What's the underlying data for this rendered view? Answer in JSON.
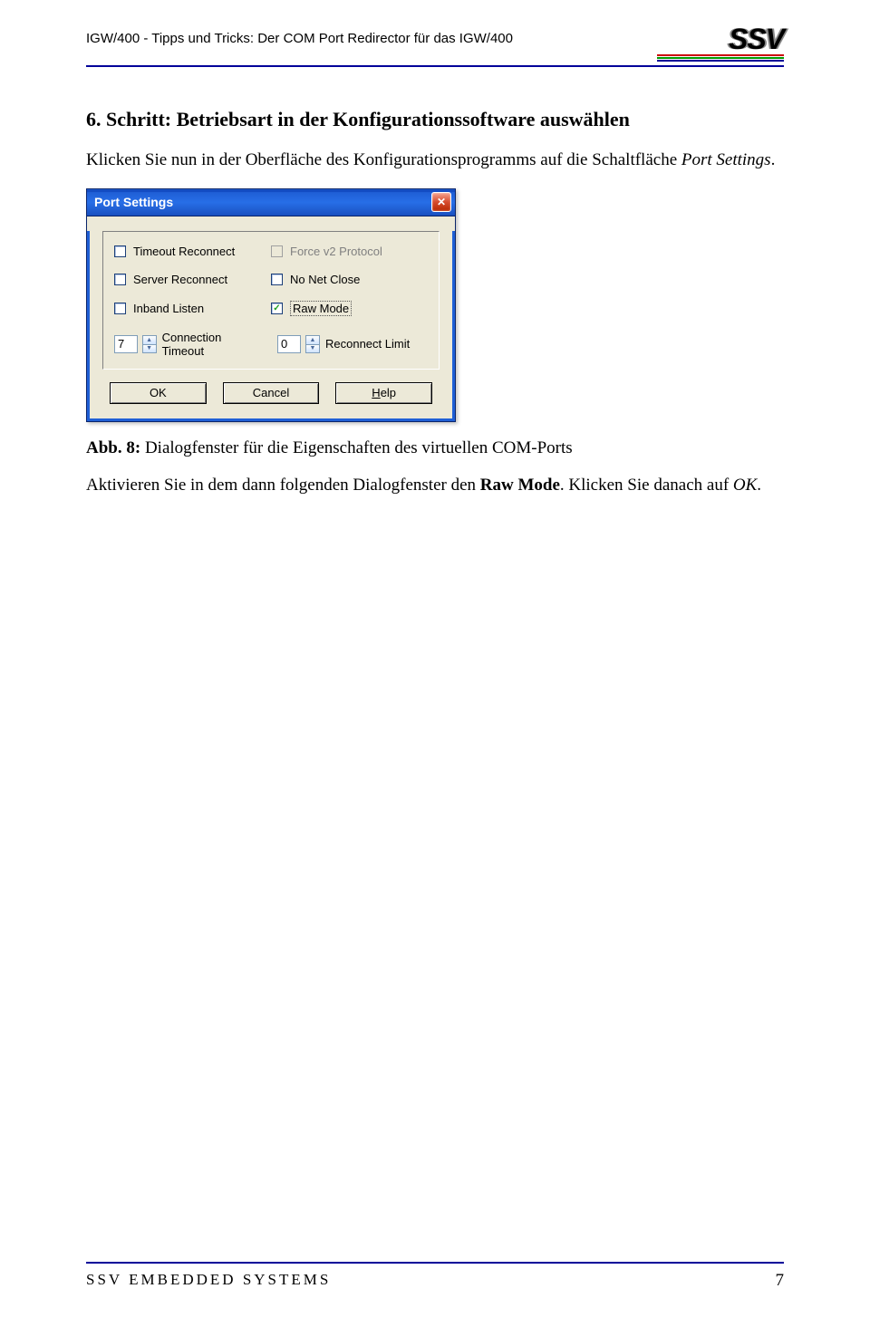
{
  "header": {
    "doc_title": "IGW/400 - Tipps und Tricks: Der COM Port Redirector für das IGW/400",
    "logo_text": "SSV"
  },
  "section": {
    "title": "6. Schritt: Betriebsart in der Konfigurationssoftware auswählen",
    "intro_a": "Klicken Sie nun in der Oberfläche des Konfigurationsprogramms auf die Schaltfläche ",
    "intro_b": "Port Settings",
    "intro_c": "."
  },
  "dialog": {
    "title": "Port Settings",
    "options": {
      "timeout_reconnect": "Timeout Reconnect",
      "force_v2": "Force v2 Protocol",
      "server_reconnect": "Server Reconnect",
      "no_net_close": "No Net Close",
      "inband_listen": "Inband Listen",
      "raw_mode": "Raw Mode",
      "raw_mode_checked": "✓"
    },
    "spinners": {
      "conn_timeout_val": "7",
      "conn_timeout_label": "Connection Timeout",
      "reconnect_limit_val": "0",
      "reconnect_limit_label": "Reconnect Limit"
    },
    "buttons": {
      "ok": "OK",
      "cancel": "Cancel",
      "help": "Help"
    }
  },
  "caption": {
    "label": "Abb. 8:",
    "text": " Dialogfenster für die Eigenschaften des virtuellen COM-Ports"
  },
  "after": {
    "a": "Aktivieren Sie in dem dann folgenden Dialogfenster den ",
    "b": "Raw Mode",
    "c": ". Klicken Sie danach auf ",
    "d": "OK",
    "e": "."
  },
  "footer": {
    "left": "SSV EMBEDDED SYSTEMS",
    "page": "7"
  }
}
